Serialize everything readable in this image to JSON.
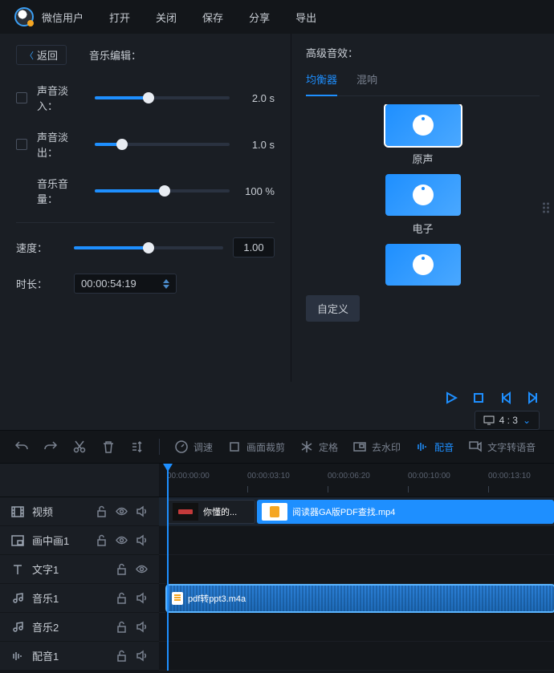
{
  "topbar": {
    "username": "微信用户",
    "menu": [
      "打开",
      "关闭",
      "保存",
      "分享",
      "导出"
    ]
  },
  "leftPanel": {
    "back": "返回",
    "title": "音乐编辑：",
    "fadeIn": {
      "label": "声音淡入：",
      "value": "2.0 s",
      "pct": 40
    },
    "fadeOut": {
      "label": "声音淡出：",
      "value": "1.0 s",
      "pct": 20
    },
    "volume": {
      "label": "音乐音量：",
      "value": "100 %",
      "pct": 52
    },
    "speed": {
      "label": "速度：",
      "value": "1.00",
      "pct": 50
    },
    "duration": {
      "label": "时长：",
      "value": "00:00:54:19"
    }
  },
  "rightPanel": {
    "title": "高级音效：",
    "tabs": [
      "均衡器",
      "混响"
    ],
    "presets": [
      "原声",
      "电子",
      ""
    ],
    "custom": "自定义"
  },
  "playback": {
    "aspect": "4 : 3"
  },
  "toolbar": {
    "btns": [
      "调速",
      "画面裁剪",
      "定格",
      "去水印",
      "配音",
      "文字转语音"
    ]
  },
  "ruler": [
    "00:00:00:00",
    "00:00:03:10",
    "00:00:06:20",
    "00:00:10:00",
    "00:00:13:10"
  ],
  "tracks": [
    {
      "name": "视频",
      "icon": "film",
      "ctrls": [
        "lock",
        "eye",
        "sound"
      ]
    },
    {
      "name": "画中画1",
      "icon": "pip",
      "ctrls": [
        "lock",
        "eye",
        "sound"
      ]
    },
    {
      "name": "文字1",
      "icon": "text",
      "ctrls": [
        "lock",
        "eye"
      ]
    },
    {
      "name": "音乐1",
      "icon": "music",
      "ctrls": [
        "lock",
        "sound"
      ]
    },
    {
      "name": "音乐2",
      "icon": "music",
      "ctrls": [
        "lock",
        "sound"
      ]
    },
    {
      "name": "配音1",
      "icon": "dub",
      "ctrls": [
        "lock",
        "sound"
      ]
    }
  ],
  "clips": {
    "video1": "你懂的...",
    "video2": "阅读器GA版PDF查找.mp4",
    "audio": "pdf转ppt3.m4a"
  }
}
